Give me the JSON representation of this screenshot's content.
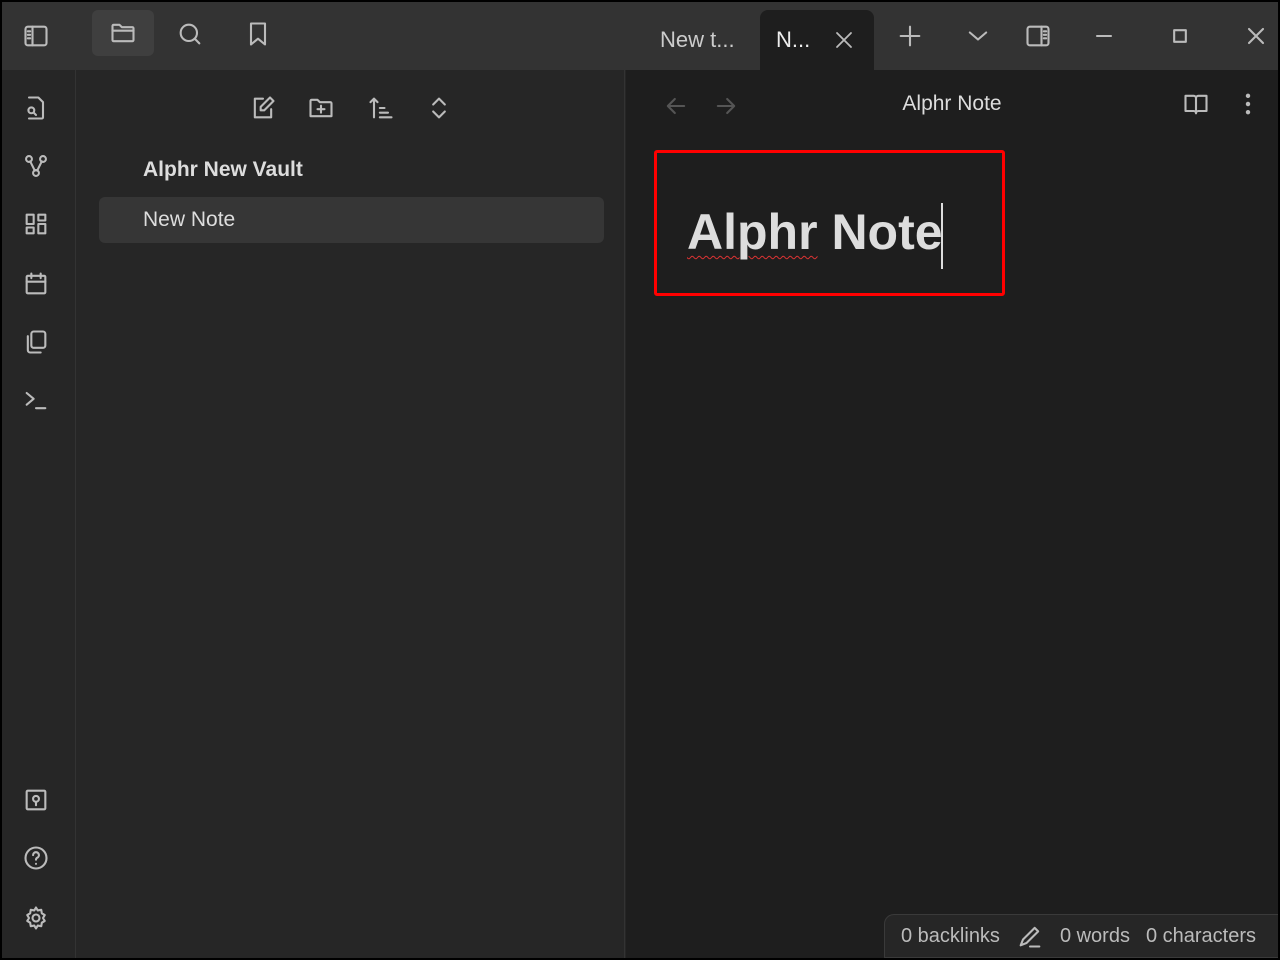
{
  "tabs": [
    {
      "label": "New t...",
      "active": false
    },
    {
      "label": "N...",
      "active": true
    }
  ],
  "vault_name": "Alphr New Vault",
  "files": [
    {
      "label": "New Note",
      "selected": true
    }
  ],
  "editor": {
    "view_title": "Alphr Note",
    "heading_word1": "Alphr",
    "heading_word2": " Note"
  },
  "status": {
    "backlinks": "0 backlinks",
    "words": "0 words",
    "characters": "0 characters"
  },
  "colors": {
    "highlight": "#ff0000"
  }
}
